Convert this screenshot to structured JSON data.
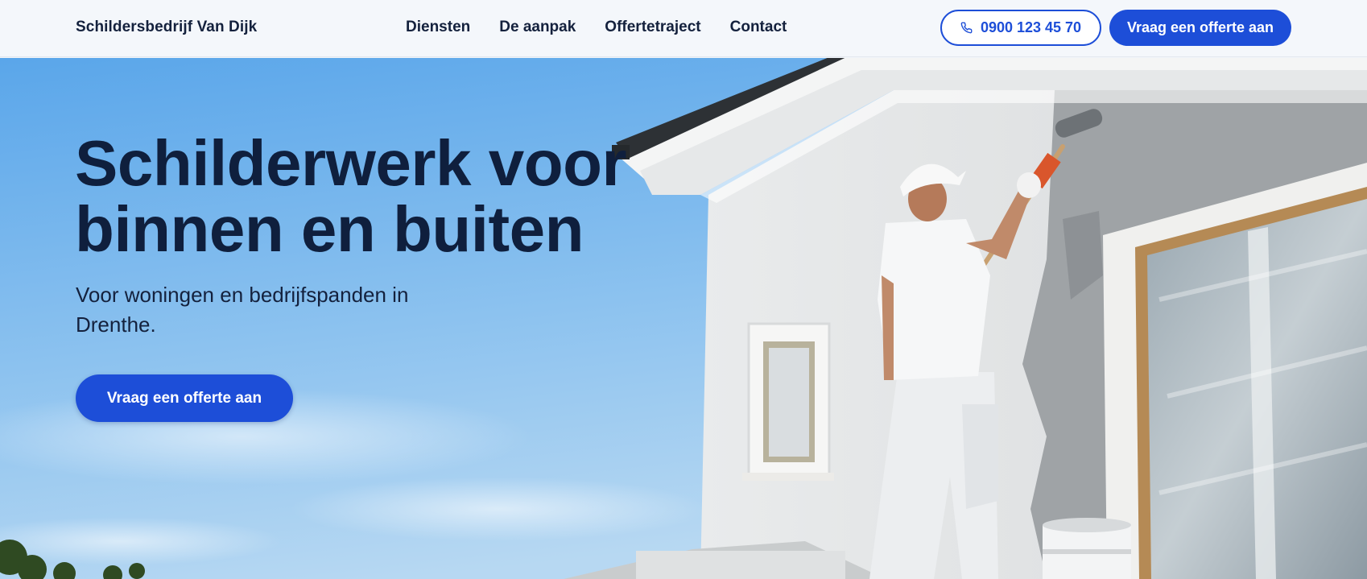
{
  "header": {
    "brand": "Schildersbedrijf Van Dijk",
    "nav": [
      "Diensten",
      "De aanpak",
      "Offertetraject",
      "Contact"
    ],
    "phone": {
      "label": "0900 123 45 70",
      "icon": "phone-icon"
    },
    "cta": "Vraag een offerte aan"
  },
  "hero": {
    "title_line1": "Schilderwerk voor",
    "title_line2": "binnen en buiten",
    "subtitle": "Voor woningen en bedrijfspanden in Drenthe.",
    "cta": "Vraag een offerte aan",
    "image_subject": "painter-on-house-facade-photo"
  },
  "colors": {
    "accent": "#1d4ed8",
    "heading": "#0f1f3d",
    "header_bg": "#f4f7fb",
    "sky": "#6fb2ea"
  }
}
